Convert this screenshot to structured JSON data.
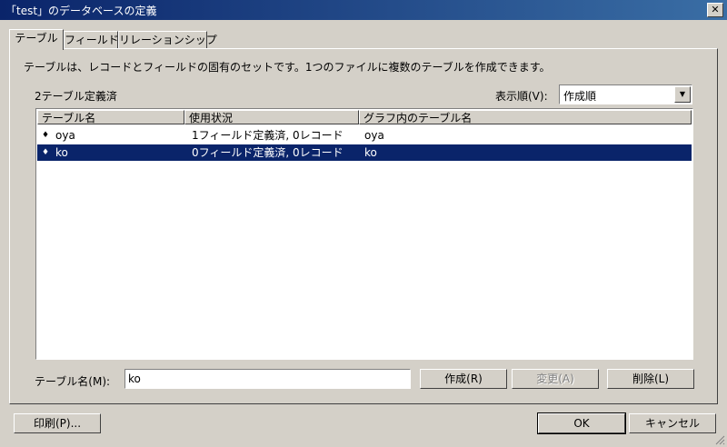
{
  "window": {
    "title": "「test」のデータベースの定義",
    "close_glyph": "✕"
  },
  "tabs": [
    {
      "label": "テーブル",
      "active": true
    },
    {
      "label": "フィールド",
      "active": false
    },
    {
      "label": "リレーションシップ",
      "active": false
    }
  ],
  "panel": {
    "description": "テーブルは、レコードとフィールドの固有のセットです。1つのファイルに複数のテーブルを作成できます。",
    "count_label": "2テーブル定義済",
    "sort_label": "表示順(V):",
    "sort_value": "作成順",
    "columns": [
      "テーブル名",
      "使用状況",
      "グラフ内のテーブル名"
    ],
    "rows": [
      {
        "icon": "♦",
        "name": "oya",
        "usage": "1フィールド定義済, 0レコード",
        "graph_name": "oya",
        "selected": false
      },
      {
        "icon": "♦",
        "name": "ko",
        "usage": "0フィールド定義済, 0レコード",
        "graph_name": "ko",
        "selected": true
      }
    ],
    "table_name_label": "テーブル名(M):",
    "table_name_value": "ko",
    "create_button": "作成(R)",
    "change_button": "変更(A)",
    "delete_button": "削除(L)"
  },
  "footer": {
    "print_button": "印刷(P)...",
    "ok_button": "OK",
    "cancel_button": "キャンセル"
  },
  "colors": {
    "title_start": "#0a246a",
    "title_end": "#3a6ea5",
    "selection": "#0a246a",
    "face": "#d4d0c8"
  }
}
